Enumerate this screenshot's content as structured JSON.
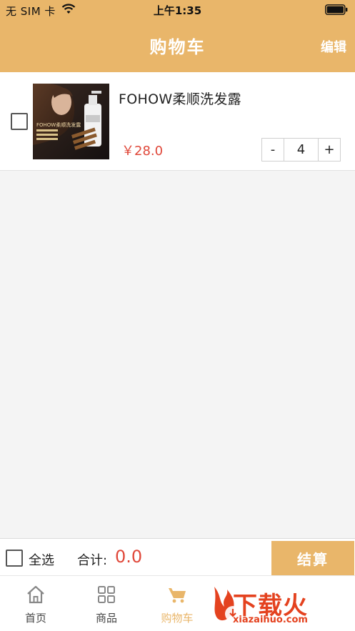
{
  "status_bar": {
    "carrier": "无 SIM 卡",
    "time": "上午1:35",
    "wifi_icon": "wifi-icon",
    "battery_icon": "battery-icon"
  },
  "nav": {
    "title": "购物车",
    "edit_label": "编辑"
  },
  "cart": {
    "items": [
      {
        "name": "FOHOW柔顺洗发露",
        "price": "￥28.0",
        "quantity": "4",
        "decrement_label": "-",
        "increment_label": "+",
        "checked": false,
        "image_text": "FOHOW柔顺洗发露"
      }
    ]
  },
  "checkout": {
    "select_all_label": "全选",
    "total_label": "合计:",
    "total_value": "0.0",
    "button_label": "结算"
  },
  "tabs": [
    {
      "label": "首页",
      "icon": "home-icon",
      "active": false
    },
    {
      "label": "商品",
      "icon": "grid-icon",
      "active": false
    },
    {
      "label": "购物车",
      "icon": "cart-icon",
      "active": true
    }
  ],
  "watermark": {
    "text": "下载火",
    "url": "xiazaihuo.com"
  },
  "colors": {
    "accent": "#e9b66a",
    "price": "#e0483a",
    "background": "#f4f4f4"
  }
}
